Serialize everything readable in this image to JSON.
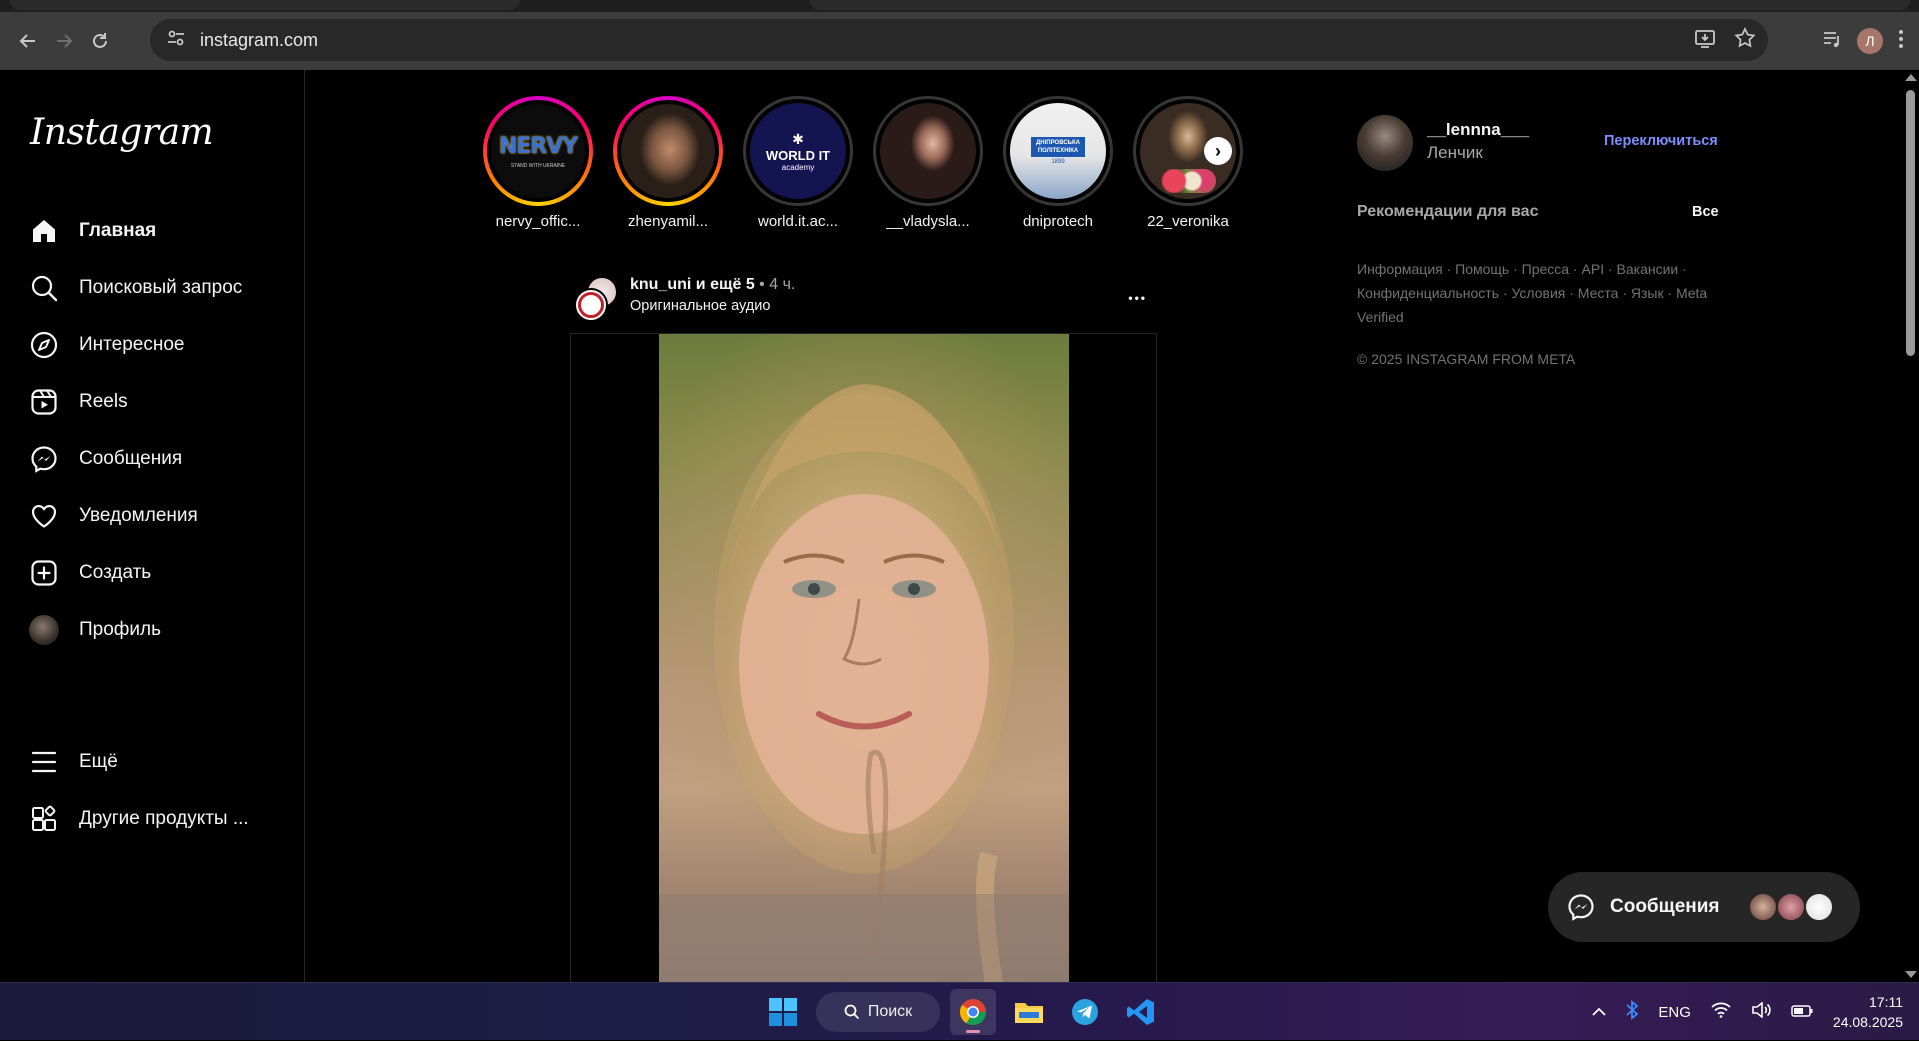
{
  "browser": {
    "url": "instagram.com",
    "profile_initial": "Л"
  },
  "instagram": {
    "logo": "Instagram",
    "nav": [
      {
        "label": "Главная",
        "icon": "home-icon"
      },
      {
        "label": "Поисковый запрос",
        "icon": "search-icon"
      },
      {
        "label": "Интересное",
        "icon": "compass-icon"
      },
      {
        "label": "Reels",
        "icon": "reels-icon"
      },
      {
        "label": "Сообщения",
        "icon": "messenger-icon"
      },
      {
        "label": "Уведомления",
        "icon": "heart-icon"
      },
      {
        "label": "Создать",
        "icon": "plus-square-icon"
      },
      {
        "label": "Профиль",
        "icon": "avatar"
      }
    ],
    "nav_bottom": [
      {
        "label": "Ещё",
        "icon": "menu-icon"
      },
      {
        "label": "Другие продукты ...",
        "icon": "grid-icon"
      }
    ],
    "stories": [
      {
        "username": "nervy_offic...",
        "seen": false
      },
      {
        "username": "zhenyamil...",
        "seen": false
      },
      {
        "username": "world.it.ac...",
        "seen": true
      },
      {
        "username": "__vladysla...",
        "seen": true
      },
      {
        "username": "dniprotech",
        "seen": true
      },
      {
        "username": "22_veronika",
        "seen": true
      }
    ],
    "story_avatar_text": {
      "nervy": "NERVY",
      "nervy_sub": "STAND WITH UKRAINE",
      "worldit": "WORLD IT",
      "worldit_sub": "academy",
      "dnipro": "ДНІПРОВСЬКА ПОЛІТЕХНІКА",
      "dnipro_year": "1899"
    },
    "post": {
      "author": "knu_uni",
      "coauthors": " и ещё 5",
      "separator": " • ",
      "time": "4 ч.",
      "audio": "Оригинальное аудио",
      "more": "•••"
    },
    "sidebar_right": {
      "username": "__lennna___",
      "fullname": "Ленчик",
      "switch_label": "Переключиться",
      "recommendations_title": "Рекомендации для вас",
      "recommendations_all": "Все",
      "footer_links": "Информация · Помощь · Пресса · API · Вакансии · Конфиденциальность · Условия · Места · Язык · Meta Verified",
      "copyright": "© 2025 INSTAGRAM FROM META"
    },
    "messages_pill": {
      "label": "Сообщения"
    }
  },
  "taskbar": {
    "search_label": "Поиск",
    "language": "ENG",
    "time": "17:11",
    "date": "24.08.2025"
  },
  "colors": {
    "accent_link": "#7c8ffe",
    "background": "#000000",
    "story_ring": "#ff0069"
  }
}
